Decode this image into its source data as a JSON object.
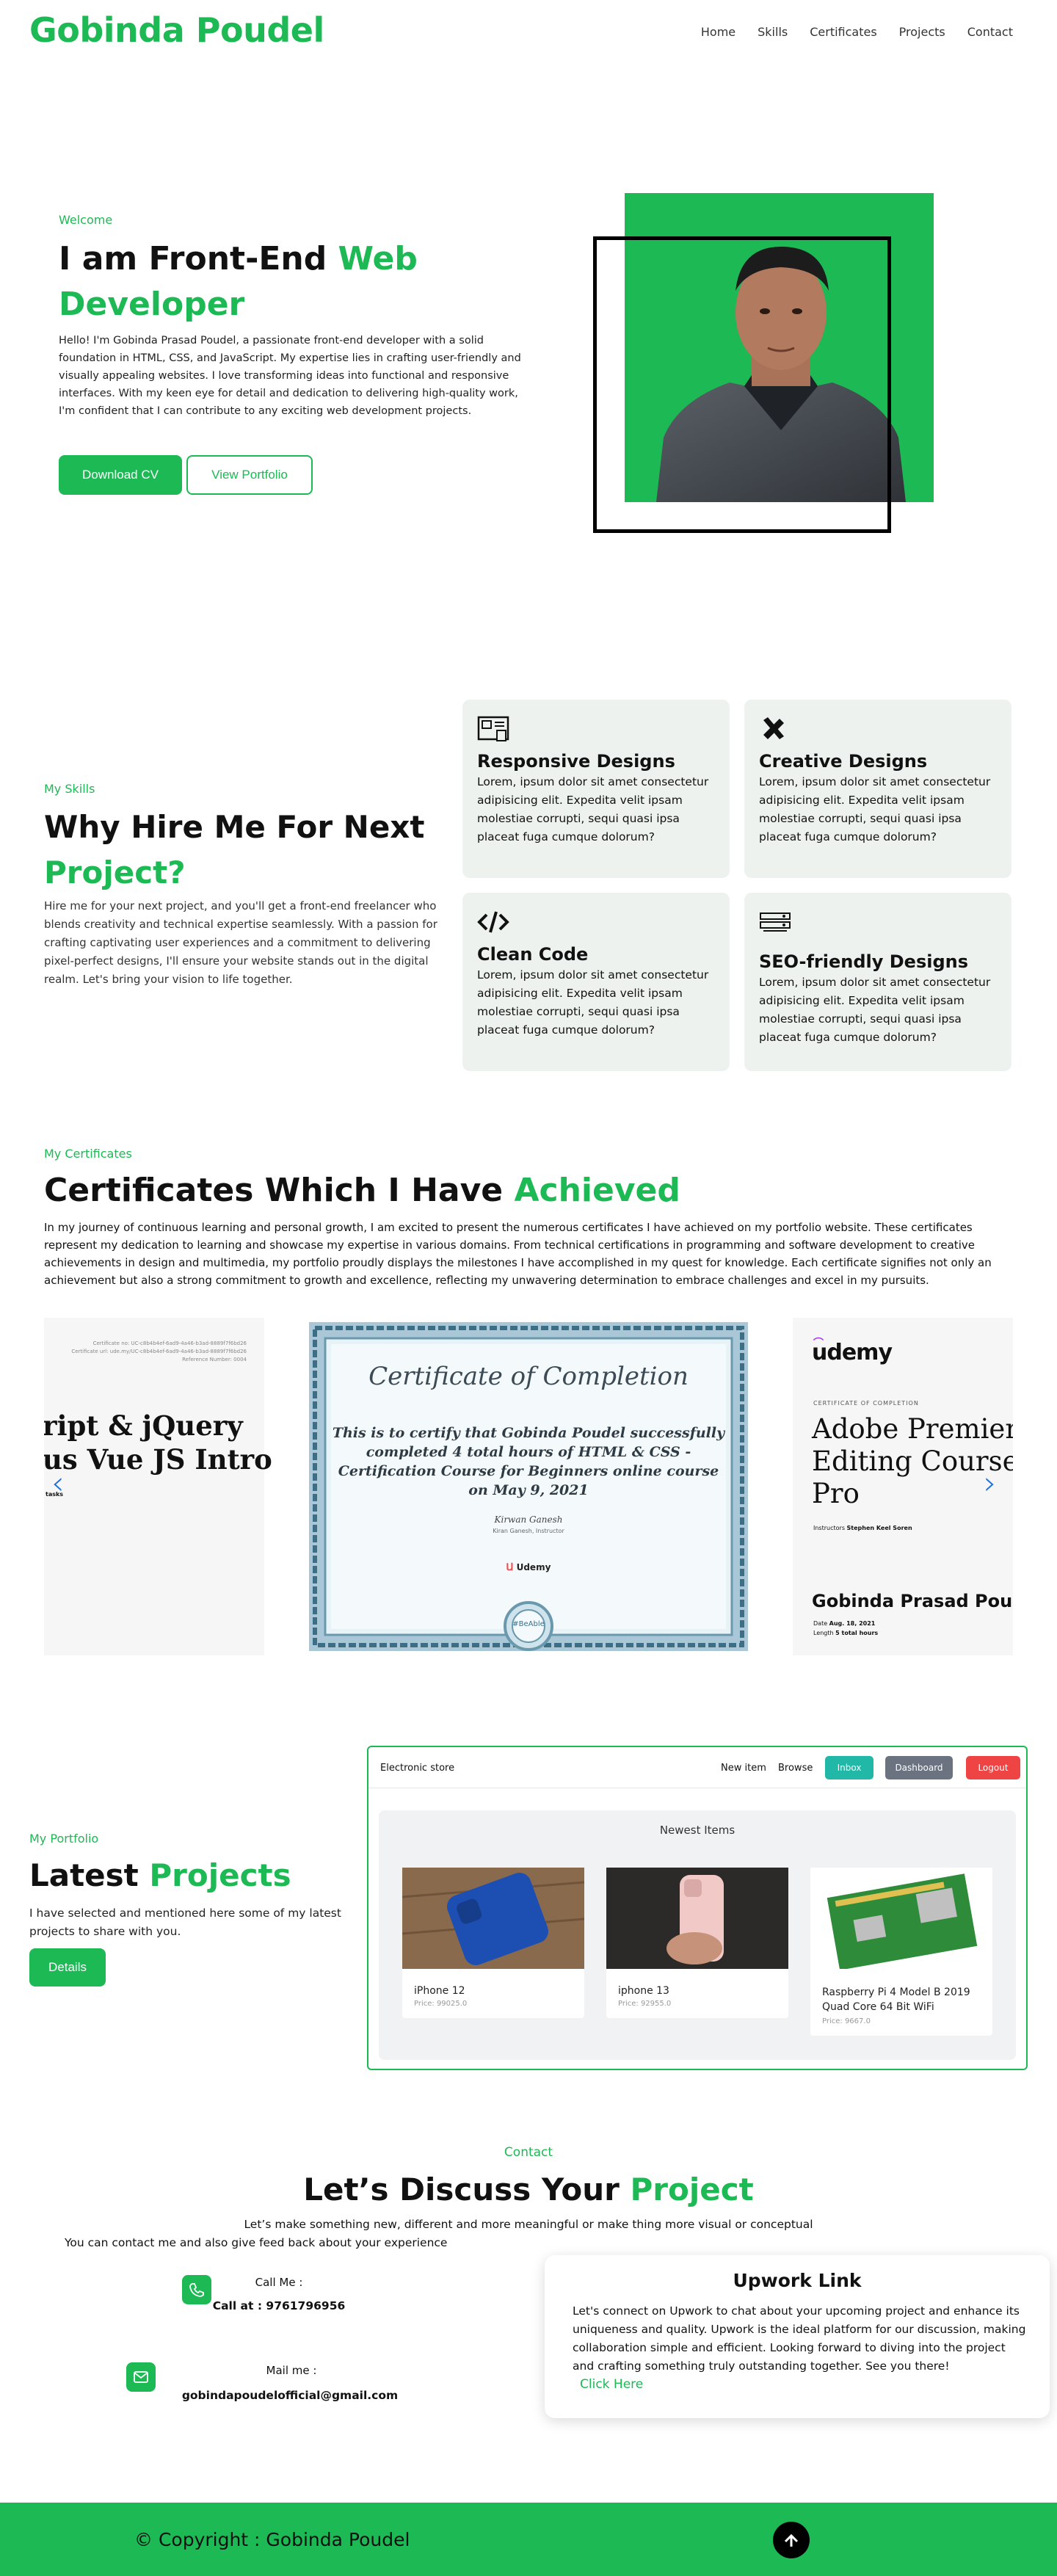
{
  "brand": {
    "logo": "Gobinda Poudel"
  },
  "nav": {
    "items": [
      "Home",
      "Skills",
      "Certificates",
      "Projects",
      "Contact"
    ]
  },
  "hero": {
    "welcome": "Welcome",
    "title_prefix": "I am Front-End ",
    "title_highlight": "Web Developer",
    "text": "Hello! I'm Gobinda Prasad Poudel, a passionate front-end developer with a solid foundation in HTML, CSS, and JavaScript. My expertise lies in crafting user-friendly and visually appealing websites. I love transforming ideas into functional and responsive interfaces. With my keen eye for detail and dedication to delivering high-quality work, I'm confident that I can contribute to any exciting web development projects.",
    "download_label": "Download CV",
    "portfolio_label": "View Portfolio"
  },
  "skills": {
    "tag": "My Skills",
    "title_prefix": "Why Hire Me For Next ",
    "title_highlight": "Project?",
    "text": "Hire me for your next project, and you'll get a front-end freelancer who blends creativity and technical expertise seamlessly. With a passion for crafting captivating user experiences and a commitment to delivering pixel-perfect designs, I'll ensure your website stands out in the digital realm. Let's bring your vision to life together.",
    "cards": [
      {
        "icon": "layout-icon",
        "title": "Responsive Designs",
        "text": "Lorem, ipsum dolor sit amet consectetur adipisicing elit. Expedita velit ipsam molestiae corrupti, sequi quasi ipsa placeat fuga cumque dolorum?"
      },
      {
        "icon": "design-tools-icon",
        "title": "Creative Designs",
        "text": "Lorem, ipsum dolor sit amet consectetur adipisicing elit. Expedita velit ipsam molestiae corrupti, sequi quasi ipsa placeat fuga cumque dolorum?"
      },
      {
        "icon": "code-icon",
        "title": "Clean Code",
        "text": "Lorem, ipsum dolor sit amet consectetur adipisicing elit. Expedita velit ipsam molestiae corrupti, sequi quasi ipsa placeat fuga cumque dolorum?"
      },
      {
        "icon": "seo-icon",
        "title": "SEO-friendly Designs",
        "text": "Lorem, ipsum dolor sit amet consectetur adipisicing elit. Expedita velit ipsam molestiae corrupti, sequi quasi ipsa placeat fuga cumque dolorum?"
      }
    ]
  },
  "certificates": {
    "tag": "My Certificates",
    "title_prefix": "Certificates Which I Have ",
    "title_highlight": "Achieved",
    "text": "In my journey of continuous learning and personal growth, I am excited to present the numerous certificates I have achieved on my portfolio website. These certificates represent my dedication to learning and showcase my expertise in various domains. From technical certifications in programming and software development to creative achievements in design and multimedia, my portfolio proudly displays the milestones I have accomplished in my quest for knowledge. Each certificate signifies not only an achievement but also a strong commitment to growth and excellence, reflecting my unwavering determination to embrace challenges and excel in my pursuits.",
    "left_slide": {
      "line1": "ript & jQuery",
      "line2": "us Vue JS Intro",
      "fine1": "Certificate no: UC-c8b4b4ef-6ad9-4a46-b3ad-8889f7f6bd26",
      "fine2": "Certificate url: ude.my/UC-c8b4b4ef-6ad9-4a46-b3ad-8889f7f6bd26",
      "fine3": "Reference Number: 0004",
      "fine4": "tasks"
    },
    "center_slide": {
      "heading": "Certificate of Completion",
      "body_lines": [
        "This is to certify that Gobinda Poudel successfully",
        "completed 4 total hours of HTML & CSS -",
        "Certification Course for Beginners online course",
        "on May 9, 2021"
      ],
      "signature": "Kirwan  Ganesh",
      "signer": "Kiran Ganesh, Instructor",
      "brand": "Udemy",
      "badge": "#BeAble"
    },
    "right_slide": {
      "logo": "udemy",
      "caption": "CERTIFICATE OF COMPLETION",
      "course_lines": [
        "Adobe Premiere",
        "Editing Course",
        "Pro"
      ],
      "instructor_label": "Instructors",
      "instructor": "Stephen Keel Soren",
      "name": "Gobinda Prasad Poudel",
      "date_label": "Date",
      "date": "Aug. 18, 2021",
      "length_label": "Length",
      "length": "5 total hours"
    }
  },
  "portfolio": {
    "tag": "My Portfolio",
    "title_prefix": "Latest ",
    "title_highlight": "Projects",
    "text": "I have selected and mentioned here some of my latest projects to share with you.",
    "details_label": "Details",
    "shot": {
      "brand": "Electronic store",
      "links": [
        "New item",
        "Browse"
      ],
      "buttons": [
        {
          "label": "Inbox",
          "color": "#22b8a7"
        },
        {
          "label": "Dashboard",
          "color": "#6b7280"
        },
        {
          "label": "Logout",
          "color": "#ef4444"
        }
      ],
      "heading": "Newest Items",
      "items": [
        {
          "name": "iPhone 12",
          "price": "Price: 99025.0"
        },
        {
          "name": "iphone 13",
          "price": "Price: 92955.0"
        },
        {
          "name": "Raspberry Pi 4 Model B 2019 Quad Core 64 Bit WiFi",
          "price": "Price: 9667.0"
        }
      ]
    }
  },
  "contact": {
    "tag": "Contact",
    "title_prefix": "Let’s Discuss Your ",
    "title_highlight": "Project",
    "sub": "Let’s make something new, different and more meaningful or make thing more visual or conceptual",
    "sub2": "You can contact me and also give feed back about your experience",
    "call_label": "Call Me :",
    "call_value": "Call at : 9761796956",
    "mail_label": "Mail me :",
    "mail_value": "gobindapoudelofficial@gmail.com",
    "upwork_title": "Upwork Link",
    "upwork_text": "Let's connect on Upwork to chat about your upcoming project and enhance its uniqueness and quality. Upwork is the ideal platform for our discussion, making collaboration simple and efficient. Looking forward to diving into the project and crafting something truly outstanding together. See you there!",
    "upwork_click": "Click Here"
  },
  "footer": {
    "copyright": "© Copyright : Gobinda Poudel"
  },
  "colors": {
    "accent": "#1db954",
    "card_bg": "#eef2ee"
  }
}
